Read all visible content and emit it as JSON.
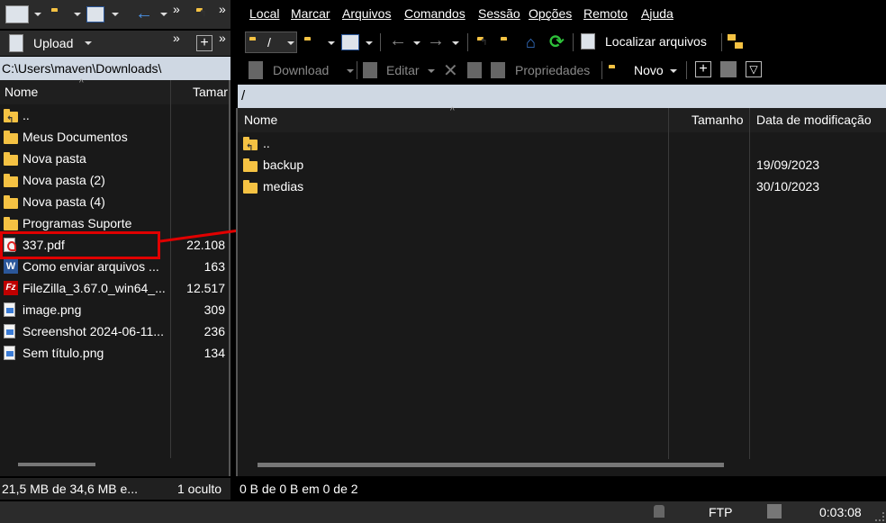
{
  "left_toolbar": {
    "upload_label": "Upload",
    "more_glyph": "»"
  },
  "left_pane": {
    "path": "C:\\Users\\maven\\Downloads\\",
    "columns": {
      "name": "Nome",
      "size": "Tamar"
    },
    "rows": [
      {
        "name": "..",
        "size": "",
        "icon": "folder-up-icon"
      },
      {
        "name": "Meus Documentos",
        "size": "",
        "icon": "folder-icon"
      },
      {
        "name": "Nova pasta",
        "size": "",
        "icon": "folder-icon"
      },
      {
        "name": "Nova pasta (2)",
        "size": "",
        "icon": "folder-icon"
      },
      {
        "name": "Nova pasta (4)",
        "size": "",
        "icon": "folder-icon"
      },
      {
        "name": "Programas Suporte",
        "size": "",
        "icon": "folder-icon"
      },
      {
        "name": "337.pdf",
        "size": "22.108",
        "icon": "pdf-file-icon"
      },
      {
        "name": "Como enviar arquivos ...",
        "size": "163",
        "icon": "word-file-icon"
      },
      {
        "name": "FileZilla_3.67.0_win64_...",
        "size": "12.517",
        "icon": "filezilla-icon"
      },
      {
        "name": "image.png",
        "size": "309",
        "icon": "image-file-icon"
      },
      {
        "name": "Screenshot 2024-06-11...",
        "size": "236",
        "icon": "image-file-icon"
      },
      {
        "name": "Sem título.png",
        "size": "134",
        "icon": "image-file-icon"
      }
    ],
    "status_size": "21,5 MB de 34,6 MB e...",
    "status_hidden": "1 oculto"
  },
  "menu": [
    "Local",
    "Marcar",
    "Arquivos",
    "Comandos",
    "Sessão",
    "Opções",
    "Remoto",
    "Ajuda"
  ],
  "right_toolbar": {
    "path_combo": "/",
    "find_files": "Localizar arquivos",
    "download": "Download",
    "edit": "Editar",
    "properties": "Propriedades",
    "new": "Novo"
  },
  "right_pane": {
    "path": "/",
    "columns": {
      "name": "Nome",
      "size": "Tamanho",
      "modified": "Data de modificação"
    },
    "rows": [
      {
        "name": "..",
        "size": "",
        "modified": "",
        "icon": "folder-up-icon"
      },
      {
        "name": "backup",
        "size": "",
        "modified": "19/09/2023",
        "icon": "folder-icon"
      },
      {
        "name": "medias",
        "size": "",
        "modified": "30/10/2023",
        "icon": "folder-icon"
      }
    ],
    "status": "0 B de 0 B em 0 de 2"
  },
  "statusbar": {
    "protocol": "FTP",
    "elapsed": "0:03:08"
  },
  "colors": {
    "annotation": "#e00000",
    "path_bar": "#cfd8e3",
    "folder": "#f5c243",
    "refresh": "#2ec13a",
    "home": "#3a7bd5"
  }
}
